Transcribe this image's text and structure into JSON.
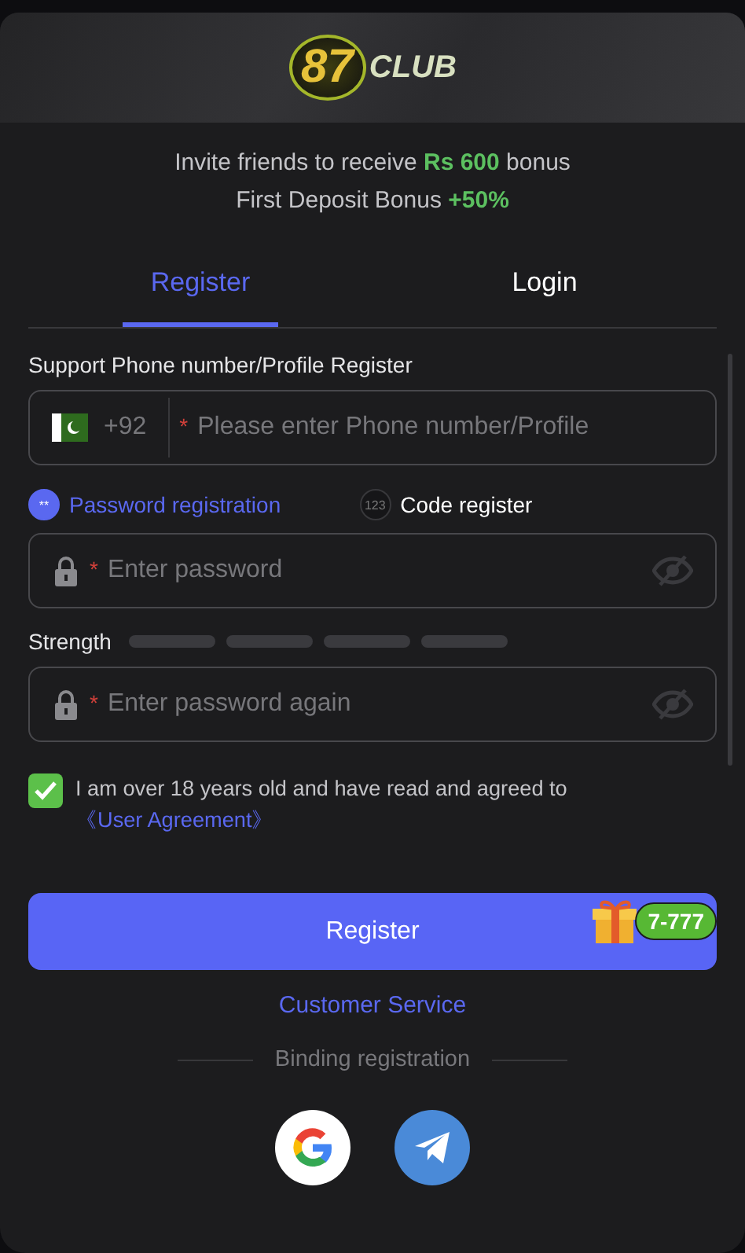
{
  "header": {
    "logo_number": "87",
    "logo_word": "CLUB"
  },
  "promo": [
    "Invite friends to receive **Rs 600** bonus",
    "First Deposit Bonus **+50%**"
  ],
  "tabs": [
    {
      "label": "Register",
      "selected": true
    },
    {
      "label": "Login",
      "selected": false
    }
  ],
  "phone_section": {
    "label": "Support Phone number/Profile Register",
    "country_code": "+92",
    "required_mark": "*",
    "placeholder": "Please enter Phone number/Profile"
  },
  "methods": [
    {
      "icon_text": "**",
      "label": "Password registration",
      "selected": true
    },
    {
      "icon_text": "123",
      "label": "Code register",
      "selected": false
    }
  ],
  "password": {
    "required_mark": "*",
    "placeholder": "Enter password",
    "visible": false
  },
  "strength": {
    "label": "Strength"
  },
  "password_again": {
    "required_mark": "*",
    "placeholder": "Enter password again",
    "visible": false
  },
  "agreement": {
    "checked": true,
    "text": "I am over 18 years old and have read and agreed to",
    "link": "《User Agreement》"
  },
  "gift_badge": "7-777",
  "register_button": "Register",
  "customer_service": "Customer Service",
  "binding_label": "Binding registration"
}
